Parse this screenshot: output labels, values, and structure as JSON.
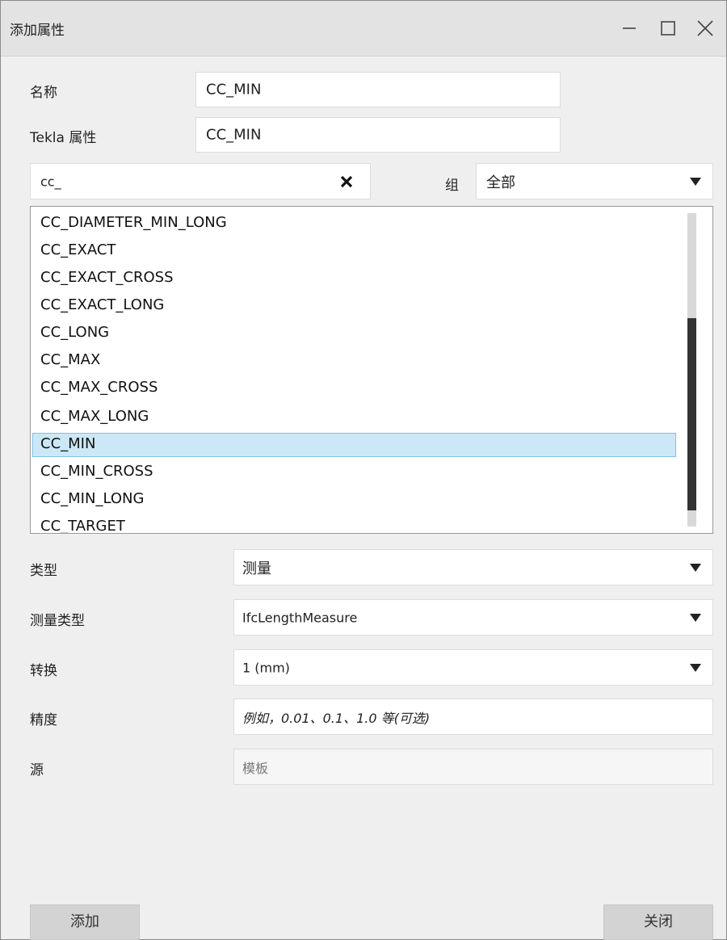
{
  "window": {
    "title": "添加属性"
  },
  "form": {
    "name_label": "名称",
    "name_value": "CC_MIN",
    "tekla_label": "Tekla 属性",
    "tekla_value": "CC_MIN"
  },
  "filter": {
    "search_value": "cc_",
    "group_label": "组",
    "group_value": "全部"
  },
  "list": {
    "items": [
      "CC_DIAMETER_MIN_LONG",
      "CC_EXACT",
      "CC_EXACT_CROSS",
      "CC_EXACT_LONG",
      "CC_LONG",
      "CC_MAX",
      "CC_MAX_CROSS",
      "CC_MAX_LONG",
      "CC_MIN",
      "CC_MIN_CROSS",
      "CC_MIN_LONG",
      "CC_TARGET"
    ],
    "selected": "CC_MIN"
  },
  "properties": {
    "type_label": "类型",
    "type_value": "测量",
    "measure_label": "测量类型",
    "measure_value": "IfcLengthMeasure",
    "convert_label": "转换",
    "convert_value": "1 (mm)",
    "precision_label": "精度",
    "precision_placeholder": "例如，0.01、0.1、1.0 等(可选)",
    "source_label": "源",
    "source_value": "模板"
  },
  "buttons": {
    "add": "添加",
    "close": "关闭"
  },
  "icons": [
    "minimize-icon",
    "maximize-icon",
    "close-icon",
    "clear-icon",
    "dropdown-arrow-icon"
  ]
}
